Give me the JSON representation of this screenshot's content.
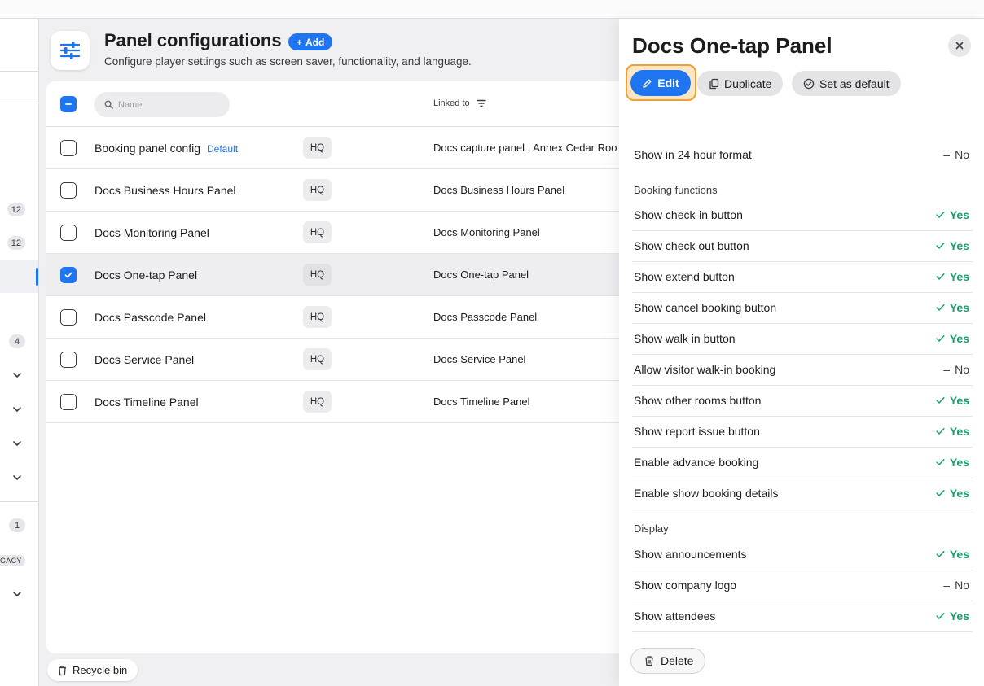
{
  "header": {
    "title": "Panel configurations",
    "add_label": "Add",
    "subtitle": "Configure player settings such as screen saver, functionality, and language."
  },
  "sidebar": {
    "counts": [
      "12",
      "12",
      "4",
      "1"
    ],
    "legacy_label": "GACY"
  },
  "table": {
    "search_placeholder": "Name",
    "linked_header": "Linked to",
    "rows": [
      {
        "name": "Booking panel config",
        "badge": "Default",
        "tag": "HQ",
        "linked": "Docs capture panel , Annex Cedar Roo",
        "checked": false
      },
      {
        "name": "Docs Business Hours Panel",
        "tag": "HQ",
        "linked": "Docs Business Hours Panel",
        "checked": false
      },
      {
        "name": "Docs Monitoring Panel",
        "tag": "HQ",
        "linked": "Docs Monitoring Panel",
        "checked": false
      },
      {
        "name": "Docs One-tap Panel",
        "tag": "HQ",
        "linked": "Docs One-tap Panel",
        "checked": true
      },
      {
        "name": "Docs Passcode Panel",
        "tag": "HQ",
        "linked": "Docs Passcode Panel",
        "checked": false
      },
      {
        "name": "Docs Service Panel",
        "tag": "HQ",
        "linked": "Docs Service Panel",
        "checked": false
      },
      {
        "name": "Docs Timeline Panel",
        "tag": "HQ",
        "linked": "Docs Timeline Panel",
        "checked": false
      }
    ]
  },
  "recycle_label": "Recycle bin",
  "panel": {
    "title": "Docs One-tap Panel",
    "edit_label": "Edit",
    "duplicate_label": "Duplicate",
    "set_default_label": "Set as default",
    "delete_label": "Delete",
    "top_setting": {
      "label": "Show in 24 hour format",
      "value": "No"
    },
    "booking_section": "Booking functions",
    "booking_settings": [
      {
        "label": "Show check-in button",
        "value": "Yes"
      },
      {
        "label": "Show check out button",
        "value": "Yes"
      },
      {
        "label": "Show extend button",
        "value": "Yes"
      },
      {
        "label": "Show cancel booking button",
        "value": "Yes"
      },
      {
        "label": "Show walk in button",
        "value": "Yes"
      },
      {
        "label": "Allow visitor walk-in booking",
        "value": "No"
      },
      {
        "label": "Show other rooms button",
        "value": "Yes"
      },
      {
        "label": "Show report issue button",
        "value": "Yes"
      },
      {
        "label": "Enable advance booking",
        "value": "Yes"
      },
      {
        "label": "Enable show booking details",
        "value": "Yes"
      }
    ],
    "display_section": "Display",
    "display_settings": [
      {
        "label": "Show announcements",
        "value": "Yes"
      },
      {
        "label": "Show company logo",
        "value": "No"
      },
      {
        "label": "Show attendees",
        "value": "Yes"
      }
    ]
  },
  "colors": {
    "accent": "#1f74f0",
    "yes": "#18a06a",
    "edit_highlight": "#f0a030"
  }
}
